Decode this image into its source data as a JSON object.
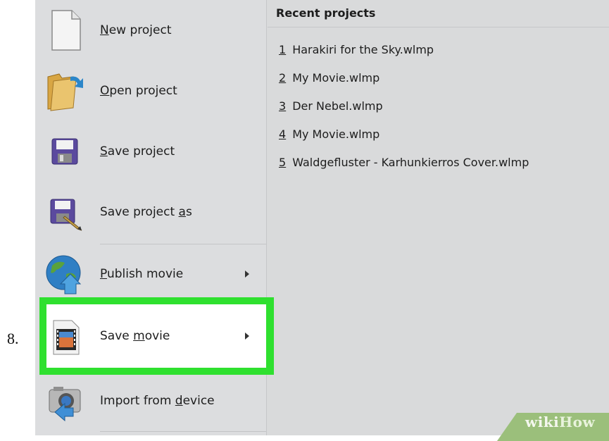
{
  "step": {
    "number": "8."
  },
  "left_menu": {
    "items": [
      {
        "id": "new",
        "pre": "",
        "ul": "N",
        "post": "ew project",
        "icon": "blank-document-icon",
        "has_submenu": false
      },
      {
        "id": "open",
        "pre": "",
        "ul": "O",
        "post": "pen project",
        "icon": "open-folder-icon",
        "has_submenu": false
      },
      {
        "id": "save",
        "pre": "",
        "ul": "S",
        "post": "ave project",
        "icon": "floppy-disk-icon",
        "has_submenu": false
      },
      {
        "id": "saveas",
        "pre": "Save project ",
        "ul": "a",
        "post": "s",
        "icon": "floppy-disk-pencil-icon",
        "has_submenu": false
      },
      {
        "id": "publish",
        "pre": "",
        "ul": "P",
        "post": "ublish movie",
        "icon": "globe-upload-icon",
        "has_submenu": true
      },
      {
        "id": "savemovie",
        "pre": "Save ",
        "ul": "m",
        "post": "ovie",
        "icon": "film-icon",
        "has_submenu": true,
        "highlighted": true
      },
      {
        "id": "import",
        "pre": "Import from ",
        "ul": "d",
        "post": "evice",
        "icon": "camera-import-icon",
        "has_submenu": false
      }
    ]
  },
  "recent": {
    "header": "Recent projects",
    "items": [
      {
        "num": "1",
        "name": "Harakiri for the Sky.wlmp"
      },
      {
        "num": "2",
        "name": "My Movie.wlmp"
      },
      {
        "num": "3",
        "name": "Der Nebel.wlmp"
      },
      {
        "num": "4",
        "name": "My Movie.wlmp"
      },
      {
        "num": "5",
        "name": "Waldgefluster -  Karhunkierros Cover.wlmp"
      }
    ]
  },
  "watermark": {
    "part1": "wiki",
    "part2": "How"
  },
  "colors": {
    "highlight": "#2fe02f",
    "menu_bg": "#dcdddf",
    "watermark_band": "#9bbf7b"
  }
}
